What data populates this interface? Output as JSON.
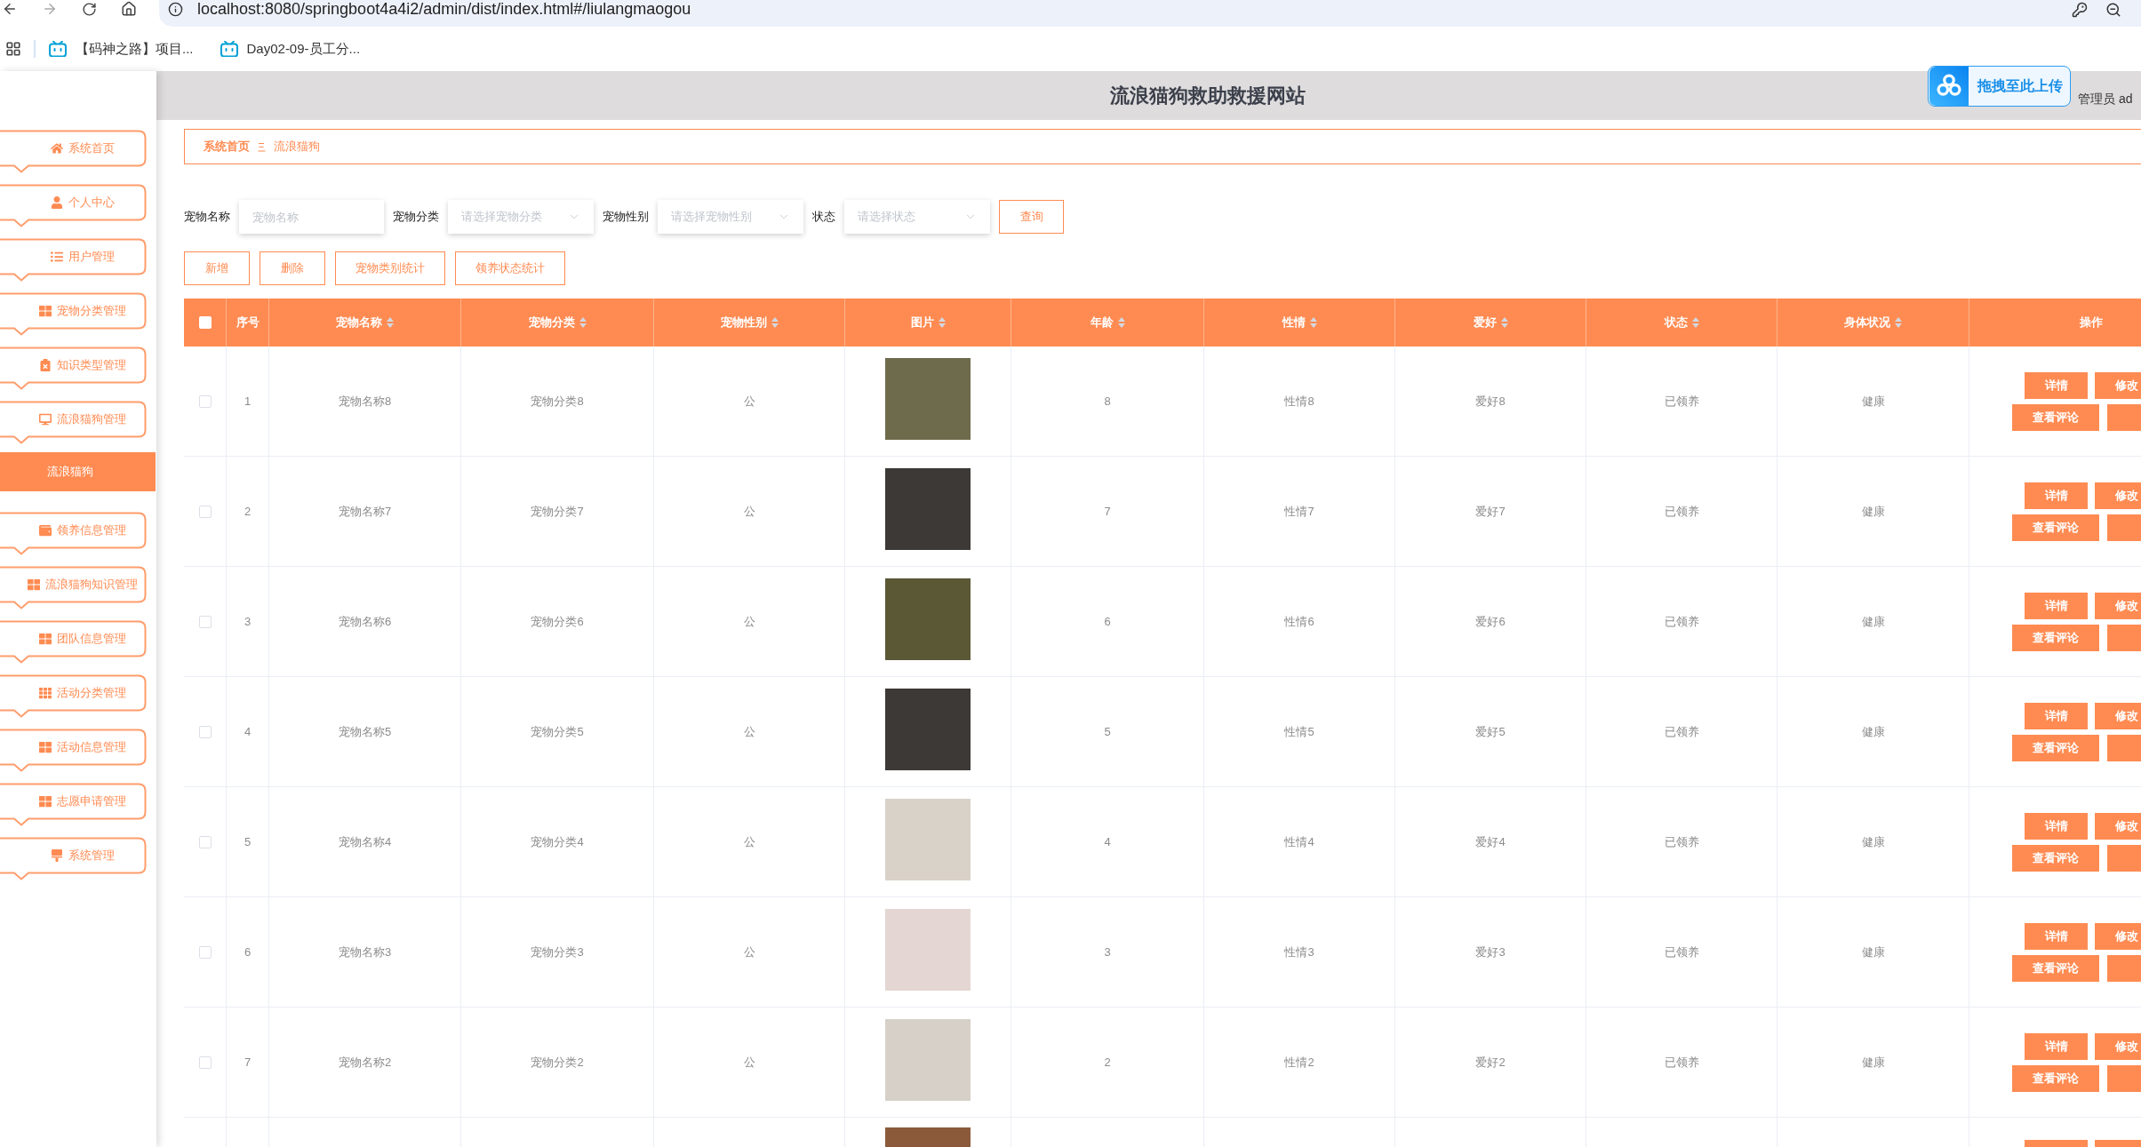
{
  "browser": {
    "url": "localhost:8080/springboot4a4i2/admin/dist/index.html#/liulangmaogou",
    "bookmarks": [
      {
        "label": "【码神之路】项目..."
      },
      {
        "label": "Day02-09-员工分..."
      }
    ]
  },
  "header": {
    "title": "流浪猫狗救助救援网站",
    "user": "管理员 ad"
  },
  "upload_widget": {
    "label": "拖拽至此上传"
  },
  "sidebar": {
    "items": [
      {
        "label": "系统首页",
        "selected": false
      },
      {
        "label": "个人中心",
        "selected": false
      },
      {
        "label": "用户管理",
        "selected": false
      },
      {
        "label": "宠物分类管理",
        "selected": false
      },
      {
        "label": "知识类型管理",
        "selected": false
      },
      {
        "label": "流浪猫狗管理",
        "selected": false,
        "children": [
          {
            "label": "流浪猫狗",
            "selected": true
          }
        ]
      },
      {
        "label": "领养信息管理",
        "selected": false
      },
      {
        "label": "流浪猫狗知识管理",
        "selected": false
      },
      {
        "label": "团队信息管理",
        "selected": false
      },
      {
        "label": "活动分类管理",
        "selected": false
      },
      {
        "label": "活动信息管理",
        "selected": false
      },
      {
        "label": "志愿申请管理",
        "selected": false
      },
      {
        "label": "系统管理",
        "selected": false
      }
    ]
  },
  "breadcrumb": [
    {
      "label": "系统首页",
      "current": false
    },
    {
      "label": "流浪猫狗",
      "current": true
    }
  ],
  "search": {
    "fields": [
      {
        "label": "宠物名称",
        "kind": "input",
        "placeholder": "宠物名称"
      },
      {
        "label": "宠物分类",
        "kind": "select",
        "placeholder": "请选择宠物分类"
      },
      {
        "label": "宠物性别",
        "kind": "select",
        "placeholder": "请选择宠物性别"
      },
      {
        "label": "状态",
        "kind": "select",
        "placeholder": "请选择状态"
      }
    ],
    "button": "查询"
  },
  "actions": [
    "新增",
    "删除",
    "宠物类别统计",
    "领养状态统计"
  ],
  "table": {
    "select_all_checked": false,
    "columns": [
      {
        "label": "序号",
        "sortable": false
      },
      {
        "label": "宠物名称",
        "sortable": true
      },
      {
        "label": "宠物分类",
        "sortable": true
      },
      {
        "label": "宠物性别",
        "sortable": true
      },
      {
        "label": "图片",
        "sortable": true
      },
      {
        "label": "年龄",
        "sortable": true
      },
      {
        "label": "性情",
        "sortable": true
      },
      {
        "label": "爱好",
        "sortable": true
      },
      {
        "label": "状态",
        "sortable": true
      },
      {
        "label": "身体状况",
        "sortable": true
      },
      {
        "label": "操作",
        "sortable": false
      }
    ],
    "rows": [
      {
        "checked": false,
        "index": "1",
        "name": "宠物名称8",
        "category": "宠物分类8",
        "gender": "公",
        "age": "8",
        "temperament": "性情8",
        "hobby": "爱好8",
        "status": "已领养",
        "health": "健康",
        "buttons": [
          "详情",
          "修改",
          "查看评论"
        ]
      },
      {
        "checked": false,
        "index": "2",
        "name": "宠物名称7",
        "category": "宠物分类7",
        "gender": "公",
        "age": "7",
        "temperament": "性情7",
        "hobby": "爱好7",
        "status": "已领养",
        "health": "健康",
        "buttons": [
          "详情",
          "修改",
          "查看评论"
        ]
      },
      {
        "checked": false,
        "index": "3",
        "name": "宠物名称6",
        "category": "宠物分类6",
        "gender": "公",
        "age": "6",
        "temperament": "性情6",
        "hobby": "爱好6",
        "status": "已领养",
        "health": "健康",
        "buttons": [
          "详情",
          "修改",
          "查看评论"
        ]
      },
      {
        "checked": false,
        "index": "4",
        "name": "宠物名称5",
        "category": "宠物分类5",
        "gender": "公",
        "age": "5",
        "temperament": "性情5",
        "hobby": "爱好5",
        "status": "已领养",
        "health": "健康",
        "buttons": [
          "详情",
          "修改",
          "查看评论"
        ]
      },
      {
        "checked": false,
        "index": "5",
        "name": "宠物名称4",
        "category": "宠物分类4",
        "gender": "公",
        "age": "4",
        "temperament": "性情4",
        "hobby": "爱好4",
        "status": "已领养",
        "health": "健康",
        "buttons": [
          "详情",
          "修改",
          "查看评论"
        ]
      },
      {
        "checked": false,
        "index": "6",
        "name": "宠物名称3",
        "category": "宠物分类3",
        "gender": "公",
        "age": "3",
        "temperament": "性情3",
        "hobby": "爱好3",
        "status": "已领养",
        "health": "健康",
        "buttons": [
          "详情",
          "修改",
          "查看评论"
        ]
      },
      {
        "checked": false,
        "index": "7",
        "name": "宠物名称2",
        "category": "宠物分类2",
        "gender": "公",
        "age": "2",
        "temperament": "性情2",
        "hobby": "爱好2",
        "status": "已领养",
        "health": "健康",
        "buttons": [
          "详情",
          "修改",
          "查看评论"
        ]
      }
    ],
    "more_rows_below": true
  }
}
